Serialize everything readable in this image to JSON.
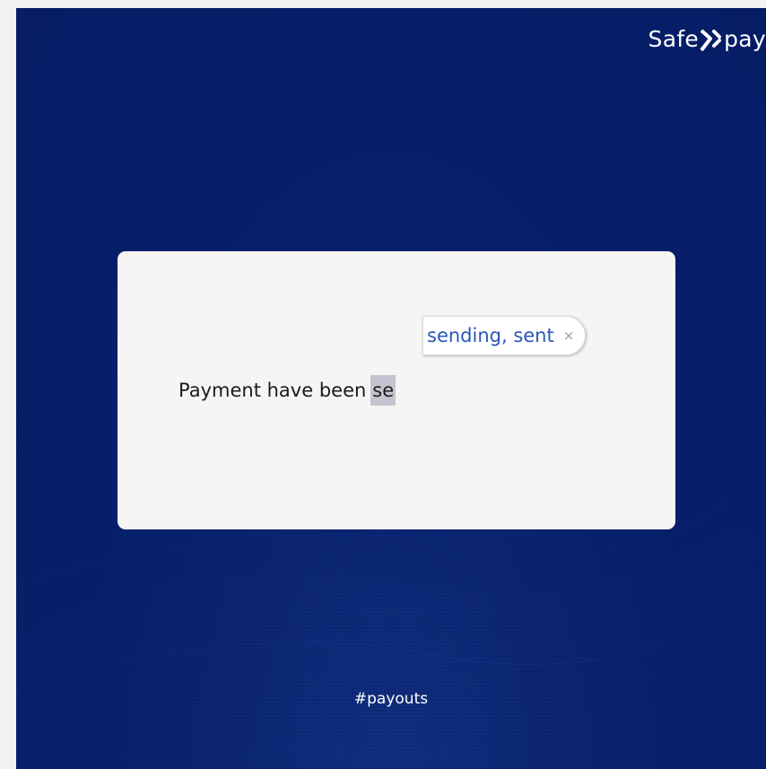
{
  "brand": {
    "name_left": "Safe",
    "name_right": "pay",
    "logo_mark": "x-chevron-mark"
  },
  "editor": {
    "sentence": "Payment have been",
    "typed_text": "se"
  },
  "autocomplete": {
    "suggestion": "sending, sent",
    "close_glyph": "×"
  },
  "footer": {
    "hashtag": "#payouts"
  },
  "colors": {
    "background": "#071f6a",
    "card": "#f6f5f4",
    "suggestion_text": "#2b56b8",
    "typed_highlight": "#c4c4d0"
  }
}
